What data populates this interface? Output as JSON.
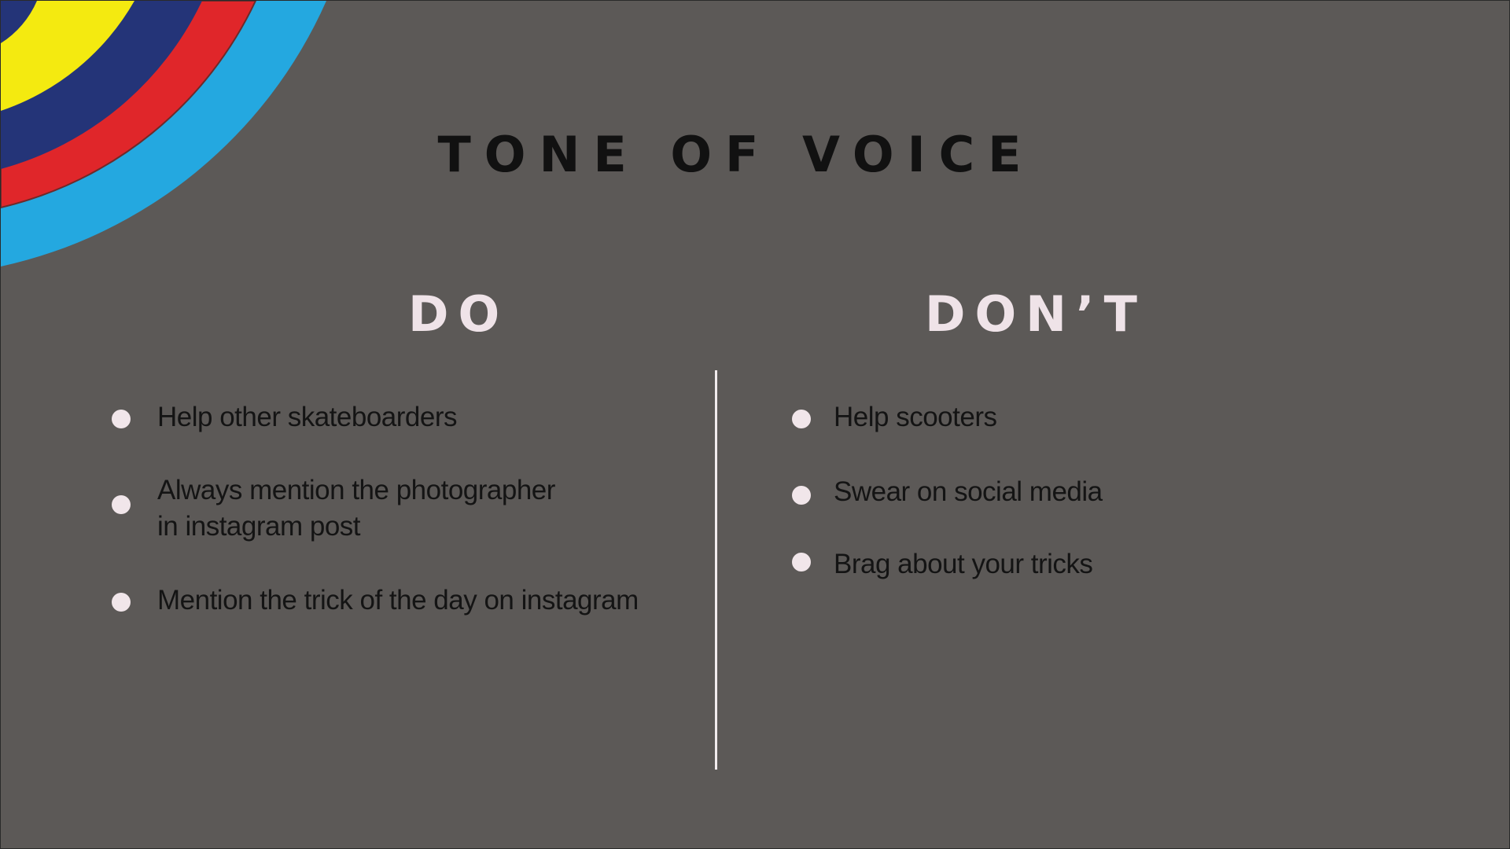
{
  "title": "TONE OF VOICE",
  "do": {
    "heading": "DO",
    "items": [
      "Help other skateboarders",
      "Always mention the photographer\nin instagram post",
      "Mention the trick of the day on instagram"
    ]
  },
  "dont": {
    "heading": "DON’T",
    "items": [
      "Help scooters",
      "Swear on social media",
      "Brag about your tricks"
    ]
  },
  "colors": {
    "background": "#5c5957",
    "arc_yellow": "#f4ea10",
    "arc_navy": "#243478",
    "arc_red": "#e0262a",
    "arc_blue": "#24a8e0",
    "heading_text": "#efe3e8",
    "title_text": "#111111"
  }
}
